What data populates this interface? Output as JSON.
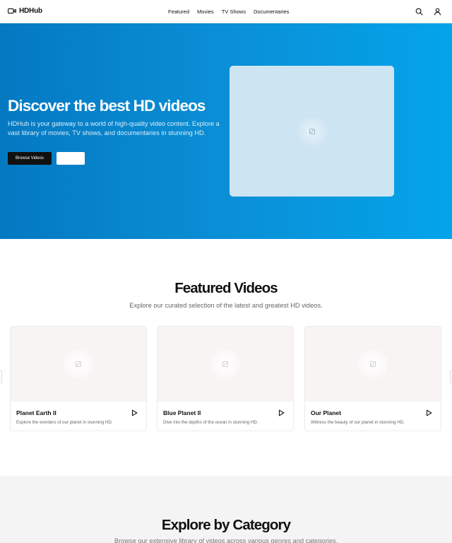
{
  "header": {
    "logo_text": "HDHub",
    "nav": [
      "Featured",
      "Movies",
      "TV Shows",
      "Documentaries"
    ],
    "icons": [
      "video-camera-icon",
      "search-icon",
      "user-icon"
    ]
  },
  "hero": {
    "title": "Discover the best HD videos",
    "description": "HDHub is your gateway to a world of high-quality video content. Explore a vast library of movies, TV shows, and documentaries in stunning HD.",
    "primary_button": "Browse Videos",
    "secondary_button": ""
  },
  "featured": {
    "title": "Featured Videos",
    "subtitle": "Explore our curated selection of the latest and greatest HD videos.",
    "cards": [
      {
        "title": "Planet Earth II",
        "description": "Explore the wonders of our planet in stunning HD."
      },
      {
        "title": "Blue Planet II",
        "description": "Dive into the depths of the ocean in stunning HD."
      },
      {
        "title": "Our Planet",
        "description": "Witness the beauty of our planet in stunning HD."
      }
    ]
  },
  "categories": {
    "title": "Explore by Category",
    "subtitle": "Browse our extensive library of videos across various genres and categories."
  },
  "colors": {
    "hero_start": "#0479c2",
    "hero_end": "#04a4ea",
    "primary_button": "#111111",
    "section_bg": "#f4f4f4"
  }
}
